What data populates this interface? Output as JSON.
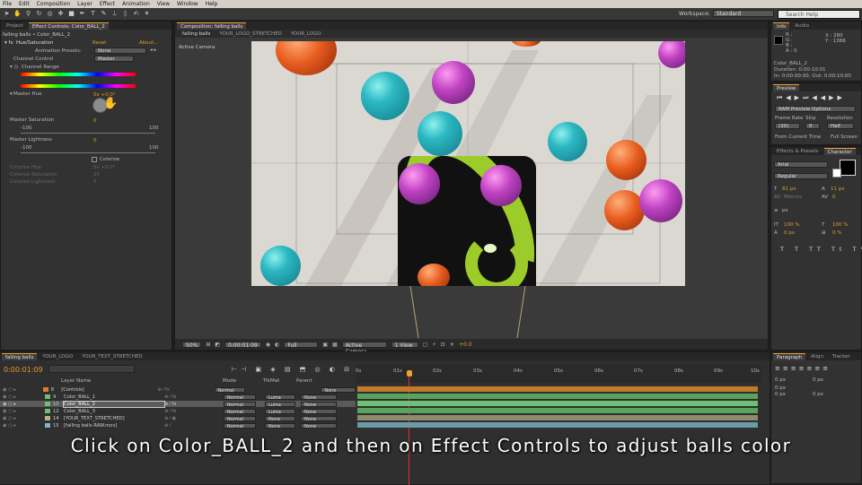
{
  "menu": [
    "File",
    "Edit",
    "Composition",
    "Layer",
    "Effect",
    "Animation",
    "View",
    "Window",
    "Help"
  ],
  "workspace": {
    "label": "Workspace:",
    "value": "Standard"
  },
  "search": {
    "placeholder": "Search Help"
  },
  "left_panel": {
    "tabs": [
      "Project",
      "Effect Controls: Color_BALL_2"
    ],
    "path": "falling balls • Color_BALL_2",
    "effect_name": "Hue/Saturation",
    "reset": "Reset",
    "about": "About...",
    "animation_presets_label": "Animation Presets:",
    "animation_presets_value": "None",
    "channel_control_label": "Channel Control",
    "channel_control_value": "Master",
    "channel_range_label": "Channel Range",
    "master_hue_label": "Master Hue",
    "master_hue_value": "0x +0.0°",
    "master_saturation_label": "Master Saturation",
    "master_saturation_value": "0",
    "sat_min": "-100",
    "sat_max": "100",
    "master_lightness_label": "Master Lightness",
    "master_lightness_value": "0",
    "light_min": "-100",
    "light_max": "100",
    "colorize_label": "Colorize",
    "colorize_hue_label": "Colorize Hue",
    "colorize_hue_value": "0x +0.0°",
    "colorize_sat_label": "Colorize Saturation",
    "colorize_sat_value": "25",
    "colorize_light_label": "Colorize Lightness",
    "colorize_light_value": "0"
  },
  "comp_panel": {
    "title": "Composition: falling balls",
    "tabs": [
      "falling balls",
      "YOUR_LOGO_STRETCHED",
      "YOUR_LOGO"
    ],
    "active_camera": "Active Camera",
    "zoom": "50%",
    "timecode": "0:00:01:09",
    "resolution": "Full",
    "camera": "Active Camera",
    "views": "1 View",
    "exposure": "+0.0"
  },
  "info_panel": {
    "tabs": [
      "Info",
      "Audio"
    ],
    "r": "R :",
    "g": "G :",
    "b": "B :",
    "a": "A : 0",
    "x": "X : 280",
    "y": "Y : 1388",
    "layer": "Color_BALL_2",
    "duration": "Duration: 0:00:10:01",
    "inout": "In: 0:00:00:00, Out: 0:00:10:00"
  },
  "preview_panel": {
    "tab": "Preview",
    "ram": "RAM Preview Options",
    "frame_rate_label": "Frame Rate",
    "skip_label": "Skip",
    "resolution_label": "Resolution",
    "frame_rate": "(30)",
    "skip": "0",
    "resolution": "Half",
    "from_current": "From Current Time",
    "full_screen": "Full Screen"
  },
  "character_panel": {
    "tabs": [
      "Effects & Presets",
      "Character"
    ],
    "font": "Arial",
    "style": "Regular",
    "size": "81 px",
    "leading": "11 px",
    "tracking": "Metrics",
    "kerning": "0",
    "vscale": "100 %",
    "hscale": "100 %",
    "baseline": "0 px",
    "tsume": "0 %",
    "unit": "px"
  },
  "paragraph_panel": {
    "tabs": [
      "Paragraph",
      "Align",
      "Tracker"
    ],
    "v1": "0 px",
    "v2": "0 px",
    "v3": "0 px",
    "v4": "0 px",
    "v5": "0 px"
  },
  "timeline": {
    "tabs": [
      "falling balls",
      "YOUR_LOGO",
      "YOUR_TEXT_STRETCHED"
    ],
    "timecode": "0:00:01:09",
    "col_layer": "Layer Name",
    "col_mode": "Mode",
    "col_trkmat": "TrkMat",
    "col_parent": "Parent",
    "ruler": [
      "0s",
      "01s",
      "02s",
      "03s",
      "04s",
      "05s",
      "06s",
      "07s",
      "08s",
      "09s",
      "10s"
    ],
    "layers": [
      {
        "num": "8",
        "name": "[Controls]",
        "color": "#e07d2a",
        "mode": "Normal",
        "trk": "",
        "parent": "None",
        "bar": "#c27a2a"
      },
      {
        "num": "9",
        "name": "Color_BALL_1",
        "color": "#6fbf6f",
        "mode": "Normal",
        "trk": "Luma",
        "parent": "None",
        "bar": "#56a45e"
      },
      {
        "num": "10",
        "name": "Color_BALL_2",
        "color": "#6fbf6f",
        "mode": "Normal",
        "trk": "Luma",
        "parent": "None",
        "bar": "#5eb067"
      },
      {
        "num": "12",
        "name": "Color_BALL_3",
        "color": "#6fbf6f",
        "mode": "Normal",
        "trk": "Luma",
        "parent": "None",
        "bar": "#56a45e"
      },
      {
        "num": "14",
        "name": "[YOUR_TEXT_STRETCHED]",
        "color": "#bdb286",
        "mode": "Normal",
        "trk": "None",
        "parent": "None",
        "bar": "#8e8a6e"
      },
      {
        "num": "15",
        "name": "[falling balls RAW.mov]",
        "color": "#7fb3c6",
        "mode": "Normal",
        "trk": "None",
        "parent": "None",
        "bar": "#6c9aa8"
      }
    ]
  },
  "caption": "Click on Color_BALL_2 and then on Effect Controls to adjust balls color"
}
